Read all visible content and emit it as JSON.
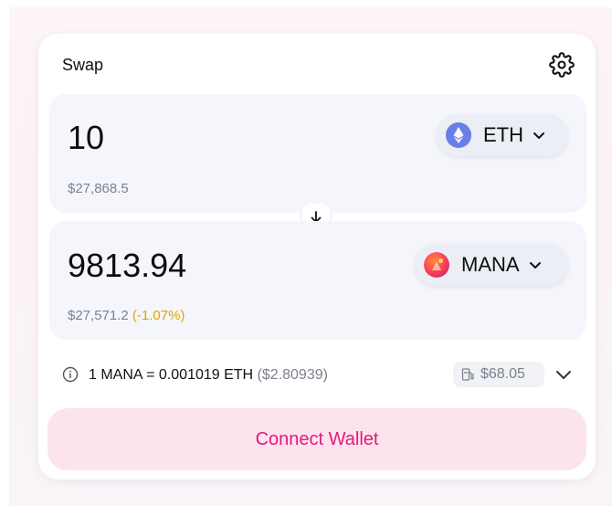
{
  "header": {
    "title": "Swap"
  },
  "input_panel": {
    "amount": "10",
    "usd_value": "$27,868.5",
    "token_symbol": "ETH",
    "token_icon": "eth-icon"
  },
  "output_panel": {
    "amount": "9813.94",
    "usd_value": "$27,571.2",
    "price_impact": "(-1.07%)",
    "token_symbol": "MANA",
    "token_icon": "mana-icon"
  },
  "rate": {
    "text": "1 MANA = 0.001019 ETH",
    "usd": "($2.80939)"
  },
  "gas": {
    "value": "$68.05"
  },
  "connect": {
    "label": "Connect Wallet"
  },
  "colors": {
    "accent": "#e21a7a",
    "connect_bg": "#fde3ee",
    "panel_bg": "#f5f6fc",
    "warning": "#e0a600"
  }
}
